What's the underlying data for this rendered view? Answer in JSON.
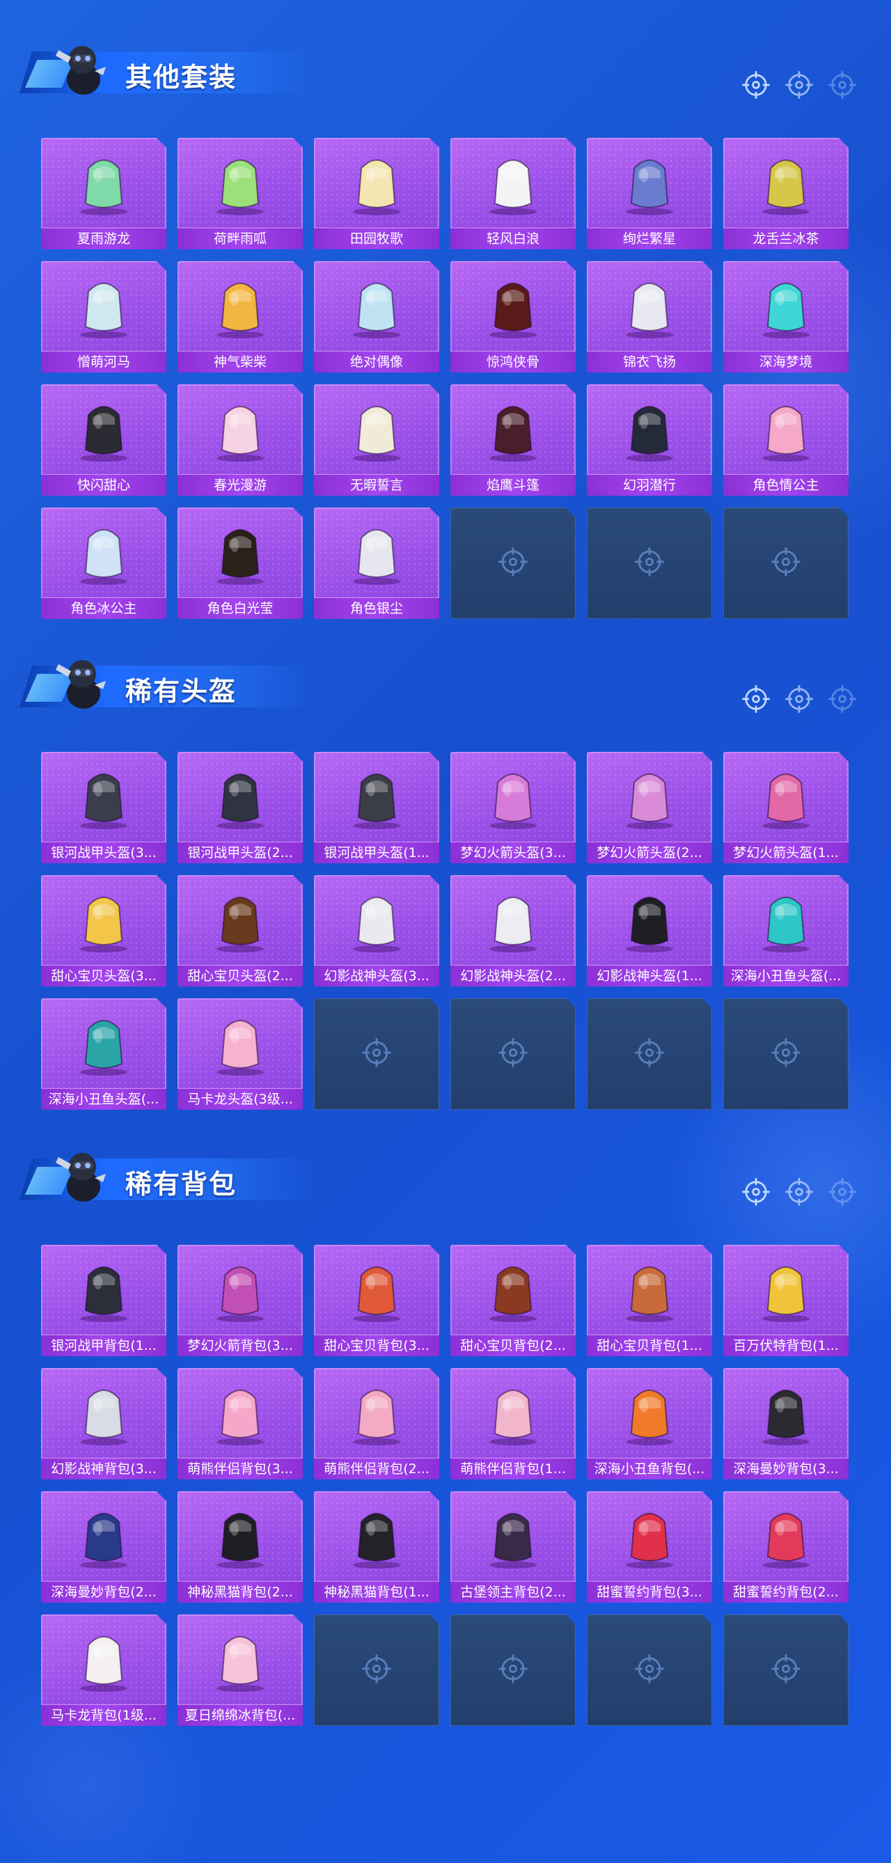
{
  "colors": {
    "background": "#1a56d8",
    "tile_purple": "#a04eed",
    "label_purple": "#8b2fd6",
    "empty_slot": "#243f6c"
  },
  "icons": {
    "mascot": "mascot-icon",
    "empty": "crosshair-icon",
    "deco": "crosshair-icon"
  },
  "sections": [
    {
      "title": "其他套装",
      "items": [
        {
          "label": "夏雨游龙",
          "color": "#7fd9a8"
        },
        {
          "label": "荷畔雨呱",
          "color": "#9be07a"
        },
        {
          "label": "田园牧歌",
          "color": "#f3e6b0"
        },
        {
          "label": "轻风白浪",
          "color": "#f4f4f4"
        },
        {
          "label": "绚烂繁星",
          "color": "#6a7ccf"
        },
        {
          "label": "龙舌兰冰茶",
          "color": "#d6c64a"
        },
        {
          "label": "憎萌河马",
          "color": "#cfe7ef"
        },
        {
          "label": "神气柴柴",
          "color": "#f2b640"
        },
        {
          "label": "绝对偶像",
          "color": "#bfe3f3"
        },
        {
          "label": "惊鸿侠骨",
          "color": "#5b1a1a"
        },
        {
          "label": "锦衣飞扬",
          "color": "#e8e8f0"
        },
        {
          "label": "深海梦境",
          "color": "#3fd6d6"
        },
        {
          "label": "快闪甜心",
          "color": "#2b2b33"
        },
        {
          "label": "春光漫游",
          "color": "#f7d2e2"
        },
        {
          "label": "无暇誓言",
          "color": "#f0ead8"
        },
        {
          "label": "焰鹰斗篷",
          "color": "#4a1e2a"
        },
        {
          "label": "幻羽潜行",
          "color": "#252a3a"
        },
        {
          "label": "角色情公主",
          "color": "#f6a8c8"
        },
        {
          "label": "角色冰公主",
          "color": "#cfe2f7"
        },
        {
          "label": "角色白光莹",
          "color": "#2a2118"
        },
        {
          "label": "角色银尘",
          "color": "#e6e6ee"
        }
      ],
      "empty_slots": 3
    },
    {
      "title": "稀有头盔",
      "items": [
        {
          "label": "银河战甲头盔(3...",
          "color": "#3a3e4c"
        },
        {
          "label": "银河战甲头盔(2...",
          "color": "#2f3440"
        },
        {
          "label": "银河战甲头盔(1...",
          "color": "#3b3e46"
        },
        {
          "label": "梦幻火箭头盔(3...",
          "color": "#d77bd8"
        },
        {
          "label": "梦幻火箭头盔(2...",
          "color": "#d98bd8"
        },
        {
          "label": "梦幻火箭头盔(1...",
          "color": "#e268a8"
        },
        {
          "label": "甜心宝贝头盔(3...",
          "color": "#f3c64a"
        },
        {
          "label": "甜心宝贝头盔(2...",
          "color": "#6a3a1e"
        },
        {
          "label": "幻影战神头盔(3...",
          "color": "#e9e9ef"
        },
        {
          "label": "幻影战神头盔(2...",
          "color": "#ececf2"
        },
        {
          "label": "幻影战神头盔(1...",
          "color": "#1e1e24"
        },
        {
          "label": "深海小丑鱼头盔(...",
          "color": "#2cc6c6"
        },
        {
          "label": "深海小丑鱼头盔(...",
          "color": "#2ba4a8"
        },
        {
          "label": "马卡龙头盔(3级...",
          "color": "#f6b2cf"
        }
      ],
      "empty_slots": 4
    },
    {
      "title": "稀有背包",
      "items": [
        {
          "label": "银河战甲背包(1...",
          "color": "#2c2f3a"
        },
        {
          "label": "梦幻火箭背包(3...",
          "color": "#c24fb3"
        },
        {
          "label": "甜心宝贝背包(3...",
          "color": "#e05a3a"
        },
        {
          "label": "甜心宝贝背包(2...",
          "color": "#8a3a22"
        },
        {
          "label": "甜心宝贝背包(1...",
          "color": "#c86a3a"
        },
        {
          "label": "百万伏特背包(1...",
          "color": "#f0c43a"
        },
        {
          "label": "幻影战神背包(3...",
          "color": "#d9dbe6"
        },
        {
          "label": "萌熊伴侣背包(3...",
          "color": "#f6a6c8"
        },
        {
          "label": "萌熊伴侣背包(2...",
          "color": "#f4aac4"
        },
        {
          "label": "萌熊伴侣背包(1...",
          "color": "#f2b6cc"
        },
        {
          "label": "深海小丑鱼背包(...",
          "color": "#f07a2a"
        },
        {
          "label": "深海曼妙背包(3...",
          "color": "#2a2a30"
        },
        {
          "label": "深海曼妙背包(2...",
          "color": "#2a3a8a"
        },
        {
          "label": "神秘黑猫背包(2...",
          "color": "#1e1e24"
        },
        {
          "label": "神秘黑猫背包(1...",
          "color": "#222228"
        },
        {
          "label": "古堡领主背包(2...",
          "color": "#3a2a4a"
        },
        {
          "label": "甜蜜誓约背包(3...",
          "color": "#e0304a"
        },
        {
          "label": "甜蜜誓约背包(2...",
          "color": "#e23a58"
        },
        {
          "label": "马卡龙背包(1级...",
          "color": "#f4f0f2"
        },
        {
          "label": "夏日绵绵冰背包(...",
          "color": "#f6c2d8"
        }
      ],
      "empty_slots": 4
    }
  ]
}
